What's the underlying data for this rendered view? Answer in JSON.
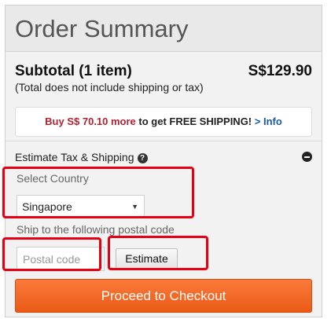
{
  "header": {
    "title": "Order Summary"
  },
  "subtotal": {
    "label": "Subtotal (1 item)",
    "value": "S$129.90",
    "note": "(Total does not include shipping or tax)"
  },
  "promo": {
    "part1": "Buy S$ 70.10 more",
    "part2": " to get FREE SHIPPING!",
    "arrow": ">",
    "link": "Info"
  },
  "estimate": {
    "label": "Estimate Tax & Shipping",
    "help_icon": "?",
    "country_label": "Select Country",
    "country_value": "Singapore",
    "postal_label": "Ship to the following postal code",
    "postal_placeholder": "Postal code",
    "estimate_button": "Estimate"
  },
  "checkout": {
    "label": "Proceed to Checkout"
  },
  "colors": {
    "checkout_orange": "#f26b26",
    "promo_red": "#b5202e",
    "link_blue": "#1a5aa6",
    "annotation_red": "#e60012"
  },
  "icons": [
    "help-icon",
    "collapse-minus-icon",
    "dropdown-arrow-icon"
  ]
}
